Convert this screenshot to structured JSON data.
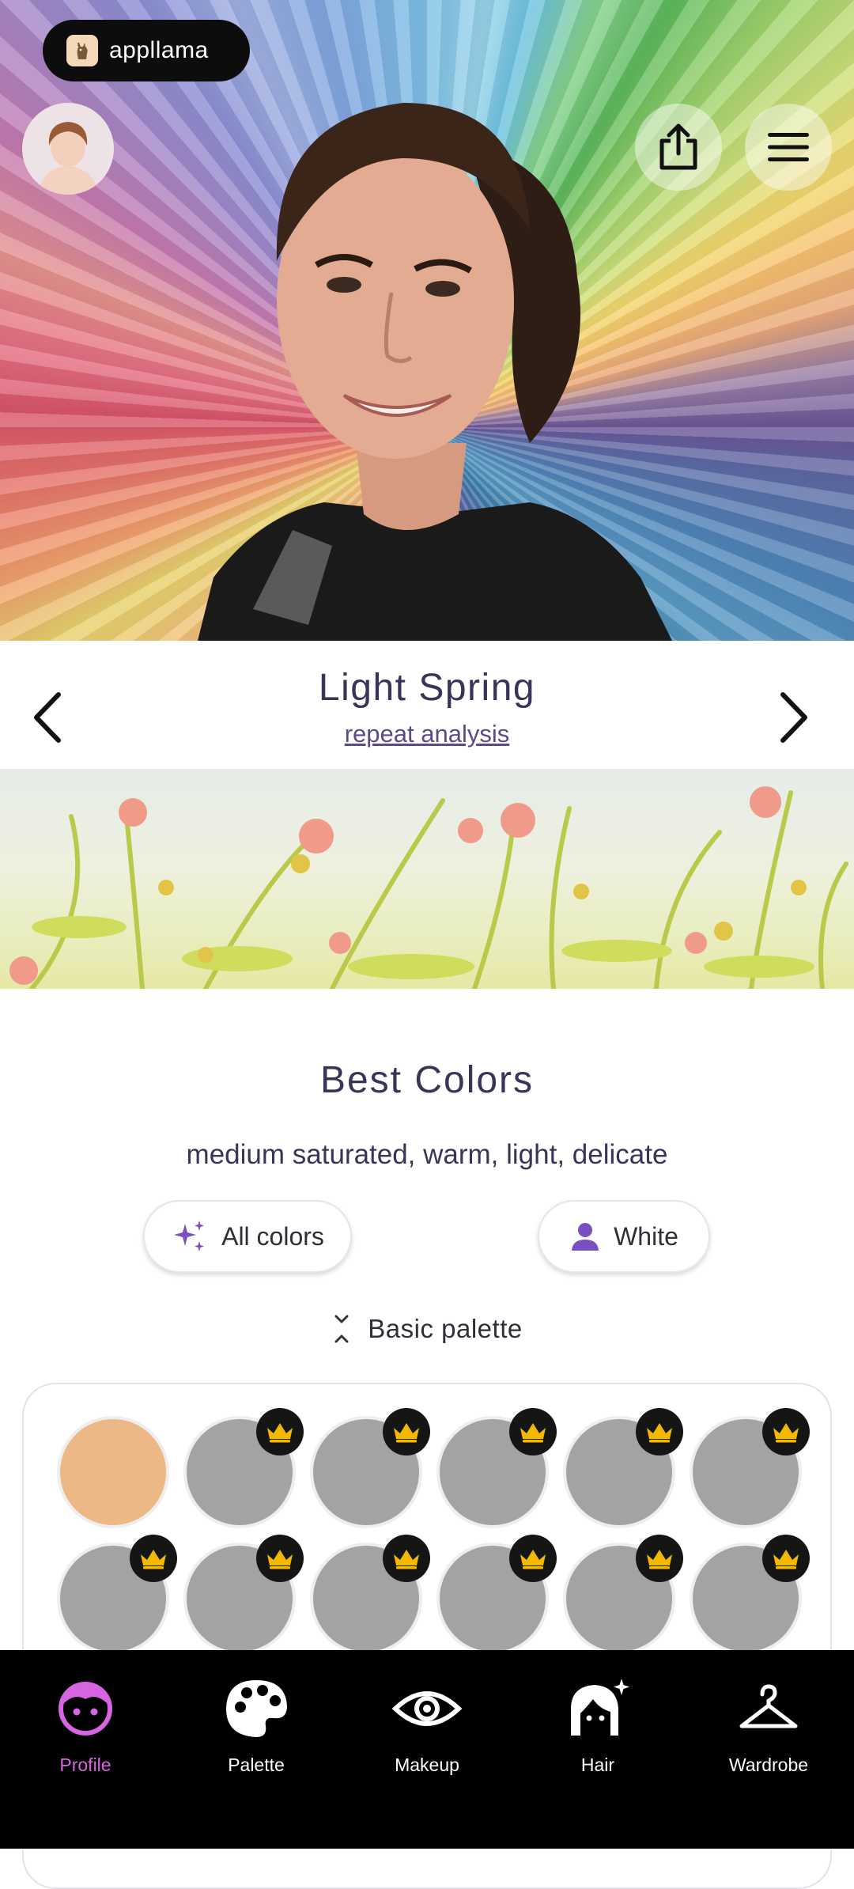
{
  "header": {
    "logo_text": "appllama"
  },
  "profile": {
    "season_title": "Light Spring",
    "repeat_link": "repeat analysis"
  },
  "best_colors": {
    "title": "Best Colors",
    "description": "medium saturated, warm, light, delicate",
    "all_colors_label": "All colors",
    "white_label": "White",
    "basic_palette_label": "Basic palette",
    "swatches": [
      {
        "color": "#ecb886",
        "locked": false
      },
      {
        "color": "#a3a3a3",
        "locked": true
      },
      {
        "color": "#a3a3a3",
        "locked": true
      },
      {
        "color": "#a3a3a3",
        "locked": true
      },
      {
        "color": "#a3a3a3",
        "locked": true
      },
      {
        "color": "#a3a3a3",
        "locked": true
      },
      {
        "color": "#a3a3a3",
        "locked": true
      },
      {
        "color": "#a3a3a3",
        "locked": true
      },
      {
        "color": "#a3a3a3",
        "locked": true
      },
      {
        "color": "#a3a3a3",
        "locked": true
      },
      {
        "color": "#a3a3a3",
        "locked": true
      },
      {
        "color": "#a3a3a3",
        "locked": true
      }
    ]
  },
  "tabs": [
    {
      "label": "Profile",
      "icon": "face-icon",
      "active": true
    },
    {
      "label": "Palette",
      "icon": "palette-icon",
      "active": false
    },
    {
      "label": "Makeup",
      "icon": "eye-icon",
      "active": false
    },
    {
      "label": "Hair",
      "icon": "hair-sparkle-icon",
      "active": false
    },
    {
      "label": "Wardrobe",
      "icon": "hanger-icon",
      "active": false
    }
  ],
  "colors": {
    "accent": "#d764e0",
    "title_text": "#3b3358",
    "crown": "#f5b800"
  }
}
